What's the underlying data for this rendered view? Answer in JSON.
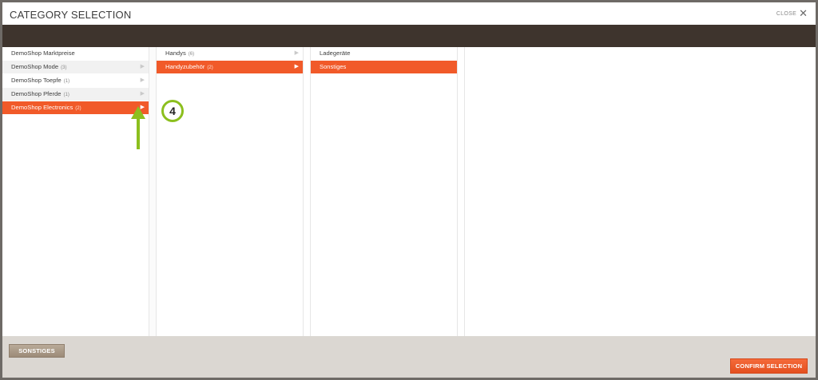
{
  "header": {
    "title": "CATEGORY SELECTION",
    "close_label": "CLOSE",
    "close_icon": "✕"
  },
  "columns": [
    {
      "items": [
        {
          "label": "DemoShop Marktpreise",
          "count": "",
          "arrow": false,
          "active": false
        },
        {
          "label": "DemoShop Mode",
          "count": "(3)",
          "arrow": true,
          "active": false
        },
        {
          "label": "DemoShop Toepfe",
          "count": "(1)",
          "arrow": true,
          "active": false
        },
        {
          "label": "DemoShop Pferde",
          "count": "(1)",
          "arrow": true,
          "active": false
        },
        {
          "label": "DemoShop Electronics",
          "count": "(2)",
          "arrow": true,
          "active": true
        }
      ]
    },
    {
      "items": [
        {
          "label": "Handys",
          "count": "(6)",
          "arrow": true,
          "active": false
        },
        {
          "label": "Handyzubehör",
          "count": "(2)",
          "arrow": true,
          "active": true
        }
      ]
    },
    {
      "items": [
        {
          "label": "Ladegeräte",
          "count": "",
          "arrow": false,
          "active": false
        },
        {
          "label": "Sonstiges",
          "count": "",
          "arrow": false,
          "active": true
        }
      ]
    }
  ],
  "arrow_glyph": "▶",
  "footer": {
    "selected_button": "SONSTIGES",
    "confirm_button": "CONFIRM SELECTION"
  },
  "annotation": {
    "step_number": "4"
  },
  "colors": {
    "accent": "#f15a29",
    "header_band": "#3e342d",
    "annotation": "#8cbf1e"
  }
}
